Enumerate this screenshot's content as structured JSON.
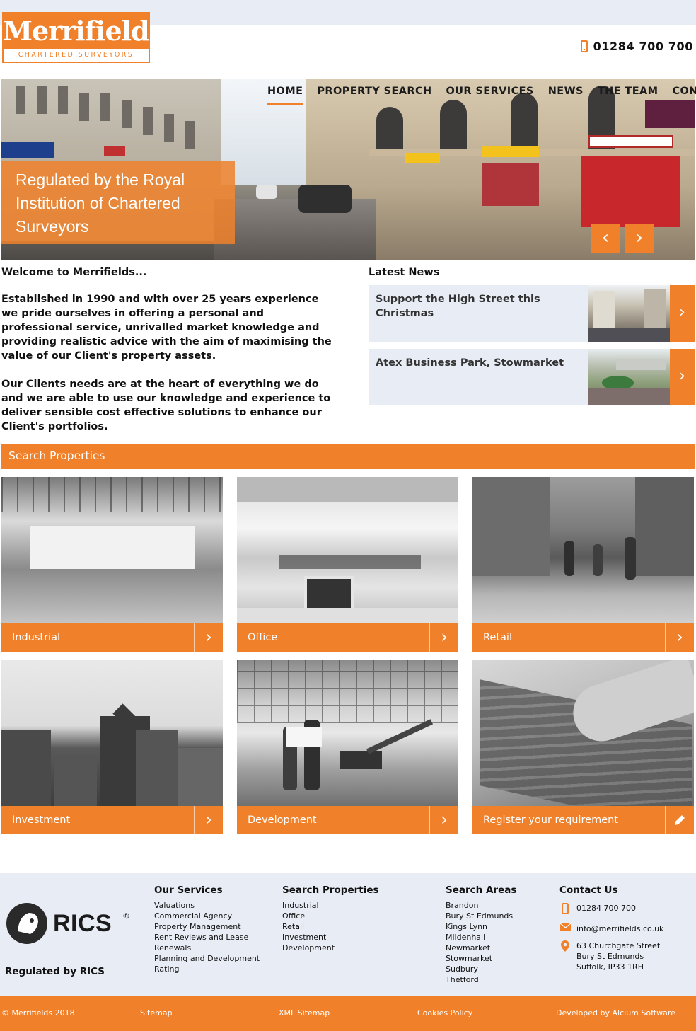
{
  "brand": {
    "name": "Merrifields",
    "tagline": "CHARTERED SURVEYORS",
    "phone": "01284 700 700",
    "accent": "#f0812a"
  },
  "nav": {
    "items": [
      "HOME",
      "PROPERTY SEARCH",
      "OUR SERVICES",
      "NEWS",
      "THE TEAM",
      "CONTACT"
    ]
  },
  "hero": {
    "caption": "Regulated by the Royal Institution of Chartered Surveyors",
    "prev": "‹",
    "next": "›"
  },
  "welcome": {
    "heading": "Welcome to Merrifields...",
    "para1": "Established in 1990 and with over 25 years experience we pride ourselves in offering a personal and professional service, unrivalled market knowledge and providing realistic advice with the aim of maximising the value of our Client's property assets.",
    "para2": "Our Clients needs are at the heart of everything we do and we are able to use our knowledge and experience to deliver sensible cost effective solutions to enhance our Client's portfolios."
  },
  "news": {
    "heading": "Latest News",
    "items": [
      {
        "title": "Support the High Street this Christmas"
      },
      {
        "title": "Atex Business Park, Stowmarket"
      }
    ]
  },
  "search": {
    "heading": "Search Properties",
    "tiles": [
      {
        "label": "Industrial",
        "icon": "chevron-right-icon"
      },
      {
        "label": "Office",
        "icon": "chevron-right-icon"
      },
      {
        "label": "Retail",
        "icon": "chevron-right-icon"
      },
      {
        "label": "Investment",
        "icon": "chevron-right-icon"
      },
      {
        "label": "Development",
        "icon": "chevron-right-icon"
      },
      {
        "label": "Register your requirement",
        "icon": "pencil-icon"
      }
    ]
  },
  "footer": {
    "regulated": "Regulated by RICS",
    "rics_text": "RICS",
    "rics_mark": "®",
    "services": {
      "heading": "Our Services",
      "links": [
        "Valuations",
        "Commercial Agency",
        "Property Management",
        "Rent Reviews and Lease",
        "Renewals",
        "Planning and Development",
        "Rating"
      ]
    },
    "properties": {
      "heading": "Search Properties",
      "links": [
        "Industrial",
        "Office",
        "Retail",
        "Investment",
        "Development"
      ]
    },
    "areas": {
      "heading": "Search Areas",
      "links": [
        "Brandon",
        "Bury St Edmunds",
        "Kings Lynn",
        "Mildenhall",
        "Newmarket",
        "Stowmarket",
        "Sudbury",
        "Thetford"
      ]
    },
    "contact": {
      "heading": "Contact Us",
      "phone": "01284 700 700",
      "email": "info@merrifields.co.uk",
      "address1": "63 Churchgate Street",
      "address2": "Bury St Edmunds",
      "address3": "Suffolk, IP33 1RH"
    }
  },
  "bottom": {
    "copyright": "© Merrifields 2018",
    "sitemap": "Sitemap",
    "xml_sitemap": "XML Sitemap",
    "cookies": "Cookies Policy",
    "developer": "Developed by Alcium Software"
  }
}
